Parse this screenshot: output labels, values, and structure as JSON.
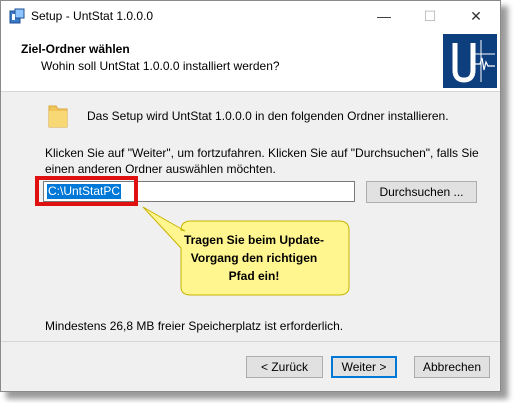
{
  "window": {
    "title": "Setup - UntStat 1.0.0.0",
    "minimize": "—",
    "maximize": "☐",
    "close": "✕"
  },
  "header": {
    "title": "Ziel-Ordner wählen",
    "subtitle": "Wohin soll UntStat 1.0.0.0 installiert werden?"
  },
  "body": {
    "intro": "Das Setup wird UntStat 1.0.0.0 in den folgenden Ordner installieren.",
    "instructions": "Klicken Sie auf \"Weiter\", um fortzufahren. Klicken Sie auf \"Durchsuchen\", falls Sie einen anderen Ordner auswählen möchten.",
    "path_value": "C:\\UntStatPC",
    "browse_label": "Durchsuchen ...",
    "callout_text": "Tragen Sie beim Update-Vorgang den richtigen Pfad ein!",
    "space_required": "Mindestens 26,8 MB freier Speicherplatz ist erforderlich."
  },
  "footer": {
    "back_label": "< Zurück",
    "next_label": "Weiter >",
    "cancel_label": "Abbrechen"
  },
  "colors": {
    "callout_fill": "#fff68f",
    "highlight_border": "#e01010",
    "selection": "#0078d7",
    "logo_bg": "#0d3f7f"
  }
}
